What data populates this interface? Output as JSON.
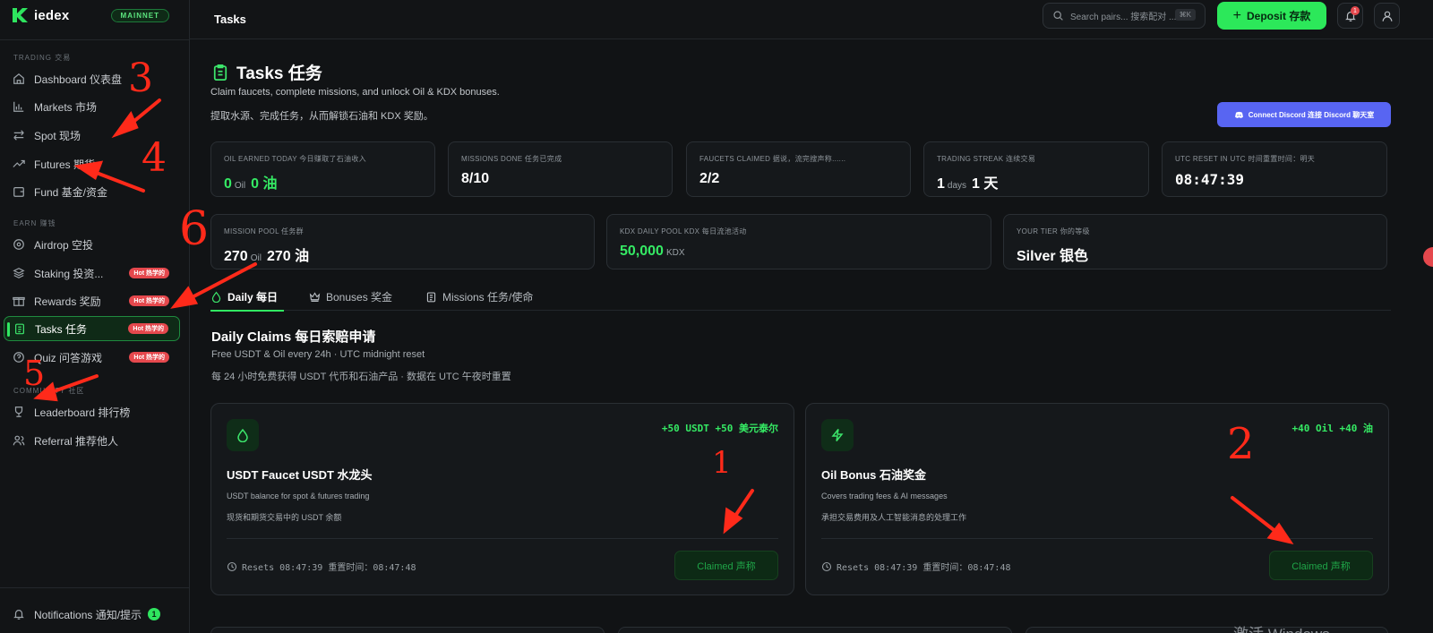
{
  "brand": {
    "logo_text": "iedex",
    "network_badge": "MAINNET"
  },
  "sidebar": {
    "sections": [
      {
        "label": "TRADING 交易"
      },
      {
        "label": "EARN 赚钱"
      },
      {
        "label": "COMMUNITY 社区"
      }
    ],
    "items": [
      {
        "label": "Dashboard 仪表盘",
        "icon": "home-icon"
      },
      {
        "label": "Markets 市场",
        "icon": "bar-chart-icon"
      },
      {
        "label": "Spot 现场",
        "icon": "swap-icon"
      },
      {
        "label": "Futures 期货",
        "icon": "trend-icon"
      },
      {
        "label": "Fund 基金/资金",
        "icon": "wallet-icon"
      },
      {
        "label": "Airdrop 空投",
        "icon": "airdrop-icon"
      },
      {
        "label": "Staking 投资...",
        "icon": "layers-icon",
        "badge": "Hot 热学的"
      },
      {
        "label": "Rewards 奖励",
        "icon": "gift-icon",
        "badge": "Hot 热学的"
      },
      {
        "label": "Tasks 任务",
        "icon": "clipboard-icon",
        "badge": "Hot 热学的"
      },
      {
        "label": "Quiz 问答游戏",
        "icon": "help-circle-icon",
        "badge": "Hot 热学的"
      },
      {
        "label": "Leaderboard 排行榜",
        "icon": "trophy-icon"
      },
      {
        "label": "Referral 推荐他人",
        "icon": "users-icon"
      }
    ],
    "notifications": {
      "label": "Notifications 通知/提示",
      "count": "1"
    }
  },
  "topbar": {
    "title": "Tasks",
    "search_placeholder": "Search pairs... 搜索配对 ...",
    "search_shortcut": "⌘K",
    "deposit_label": "Deposit 存款",
    "bell_count": "1"
  },
  "page": {
    "title": "Tasks 任务",
    "subtitle_en": "Claim faucets, complete missions, and unlock Oil & KDX bonuses.",
    "subtitle_zh": "提取水源、完成任务，从而解锁石油和 KDX 奖励。",
    "discord_label": "Connect Discord 连接 Discord 聊天室"
  },
  "stats": [
    {
      "label": "OIL EARNED TODAY 今日赚取了石油收入",
      "value": "0",
      "unit": "Oil",
      "value2": "0 油",
      "green": true
    },
    {
      "label": "MISSIONS DONE 任务已完成",
      "value": "8/10"
    },
    {
      "label": "FAUCETS CLAIMED 据说，流完搜声称......",
      "value": "2/2"
    },
    {
      "label": "TRADING STREAK 连续交易",
      "value": "1",
      "unit": "days",
      "value2": "1 天"
    },
    {
      "label": "UTC RESET IN UTC 时间重置时间：明天",
      "value": "08:47:39"
    },
    {
      "label": "MISSION POOL 任务群",
      "value": "270",
      "unit": "Oil",
      "value2": "270 油"
    },
    {
      "label": "KDX DAILY POOL KDX 每日流池活动",
      "value": "50,000",
      "unit": "KDX",
      "green": true
    },
    {
      "label": "YOUR TIER 你的等级",
      "value": "Silver 银色"
    }
  ],
  "tabs": [
    {
      "label": "Daily 每日",
      "active": true
    },
    {
      "label": "Bonuses 奖金"
    },
    {
      "label": "Missions 任务/使命"
    }
  ],
  "daily": {
    "title": "Daily Claims 每日索赔申请",
    "sub_en": "Free USDT & Oil every 24h · UTC midnight reset",
    "sub_zh": "每 24 小时免费获得 USDT 代币和石油产品 · 数据在 UTC 午夜时重置"
  },
  "cards": [
    {
      "reward": "+50 USDT  +50 美元泰尔",
      "title": "USDT Faucet USDT 水龙头",
      "desc_en": "USDT balance for spot & futures trading",
      "desc_zh": "现货和期货交易中的 USDT 余额",
      "resets": "Resets 08:47:39   重置时间：08:47:48",
      "button": "Claimed 声称"
    },
    {
      "reward": "+40 Oil  +40 油",
      "title": "Oil Bonus 石油奖金",
      "desc_en": "Covers trading fees & AI messages",
      "desc_zh": "承担交易费用及人工智能消息的处理工作",
      "resets": "Resets 08:47:39   重置时间：08:47:48",
      "button": "Claimed 声称"
    }
  ],
  "annotations": [
    "3",
    "4",
    "6",
    "5",
    "1",
    "2"
  ],
  "watermark": "激活 Windows",
  "colors": {
    "accent": "#31e862",
    "background": "#111315",
    "hot_badge": "#e5484d",
    "discord": "#5865f2",
    "annotation": "#ff2a1a"
  }
}
